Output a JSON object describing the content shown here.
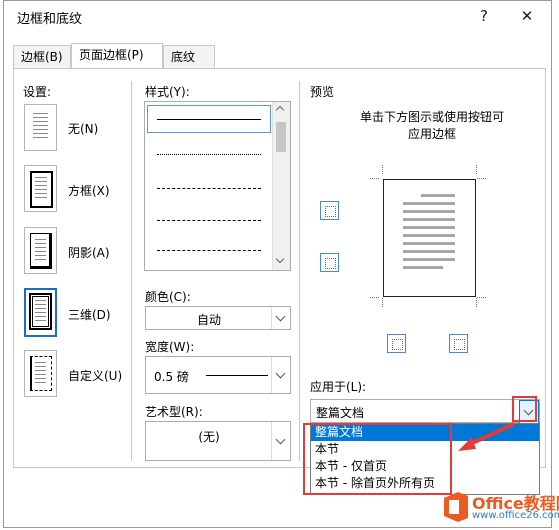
{
  "dialog": {
    "title": "边框和底纹",
    "help": "?",
    "close": "✕"
  },
  "tabs": [
    {
      "label": "边框(B)"
    },
    {
      "label": "页面边框(P)",
      "active": true
    },
    {
      "label": "底纹(S)"
    }
  ],
  "setting": {
    "heading": "设置:",
    "items": [
      {
        "label": "无(N)"
      },
      {
        "label": "方框(X)"
      },
      {
        "label": "阴影(A)"
      },
      {
        "label": "三维(D)",
        "selected": true
      },
      {
        "label": "自定义(U)"
      }
    ]
  },
  "style": {
    "heading": "样式(Y):",
    "color_label": "颜色(C):",
    "color_value": "自动",
    "width_label": "宽度(W):",
    "width_value": "0.5 磅",
    "art_label": "艺术型(R):",
    "art_value": "(无)"
  },
  "preview": {
    "heading": "预览",
    "hint_line1": "单击下方图示或使用按钮可",
    "hint_line2": "应用边框"
  },
  "apply_to": {
    "label": "应用于(L):",
    "value": "整篇文档",
    "options": [
      "整篇文档",
      "本节",
      "本节 - 仅首页",
      "本节 - 除首页外所有页"
    ],
    "selected_index": 0
  },
  "watermark": {
    "text": "Office教程网",
    "url": "www.office26.com"
  },
  "colors": {
    "accent": "#0078d7",
    "highlight": "#e33a3a"
  }
}
